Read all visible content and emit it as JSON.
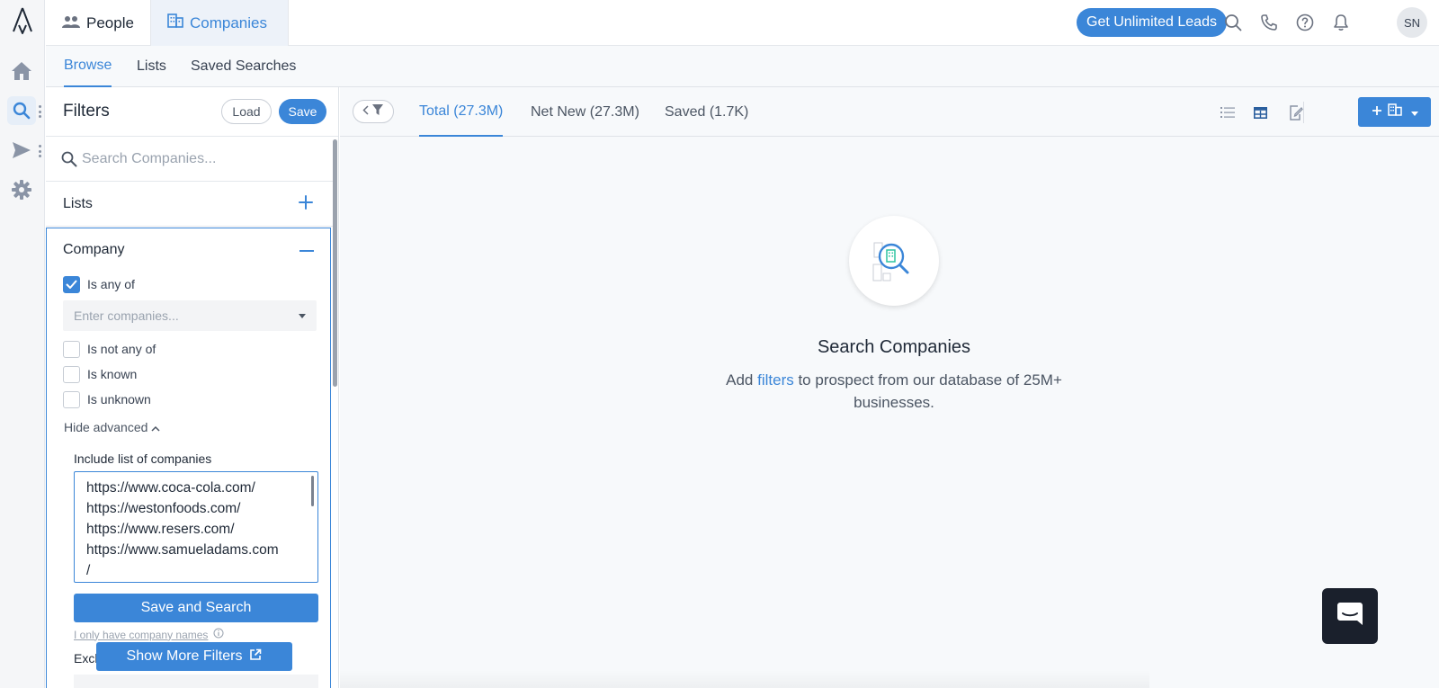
{
  "app": {
    "tabs": [
      {
        "label": "People",
        "icon": "people-icon"
      },
      {
        "label": "Companies",
        "icon": "building-icon"
      }
    ],
    "cta_label": "Get Unlimited Leads",
    "avatar_initials": "SN",
    "accent_color": "#3b86d8"
  },
  "subnav": {
    "items": [
      "Browse",
      "Lists",
      "Saved Searches"
    ]
  },
  "filters": {
    "title": "Filters",
    "load_label": "Load",
    "save_label": "Save",
    "search_placeholder": "Search Companies...",
    "lists_label": "Lists",
    "company": {
      "label": "Company",
      "options": [
        {
          "label": "Is any of",
          "checked": true
        },
        {
          "label": "Is not any of",
          "checked": false
        },
        {
          "label": "Is known",
          "checked": false
        },
        {
          "label": "Is unknown",
          "checked": false
        }
      ],
      "select_placeholder": "Enter companies...",
      "hide_advanced_label": "Hide advanced",
      "include_label": "Include list of companies",
      "include_lines": [
        "https://www.coca-cola.com/",
        "https://westonfoods.com/",
        "https://www.resers.com/",
        "https://www.samueladams.com",
        "/"
      ],
      "save_search_label": "Save and Search",
      "only_names_label": "I only have company names",
      "exclude_label": "Excl",
      "show_more_label": "Show More Filters"
    }
  },
  "results": {
    "tabs": [
      {
        "label": "Total (27.3M)",
        "active": true
      },
      {
        "label": "Net New (27.3M)",
        "active": false
      },
      {
        "label": "Saved (1.7K)",
        "active": false
      }
    ],
    "empty_title": "Search Companies",
    "empty_desc_prefix": "Add ",
    "empty_desc_link": "filters",
    "empty_desc_suffix": " to prospect from our database of 25M+ businesses."
  }
}
